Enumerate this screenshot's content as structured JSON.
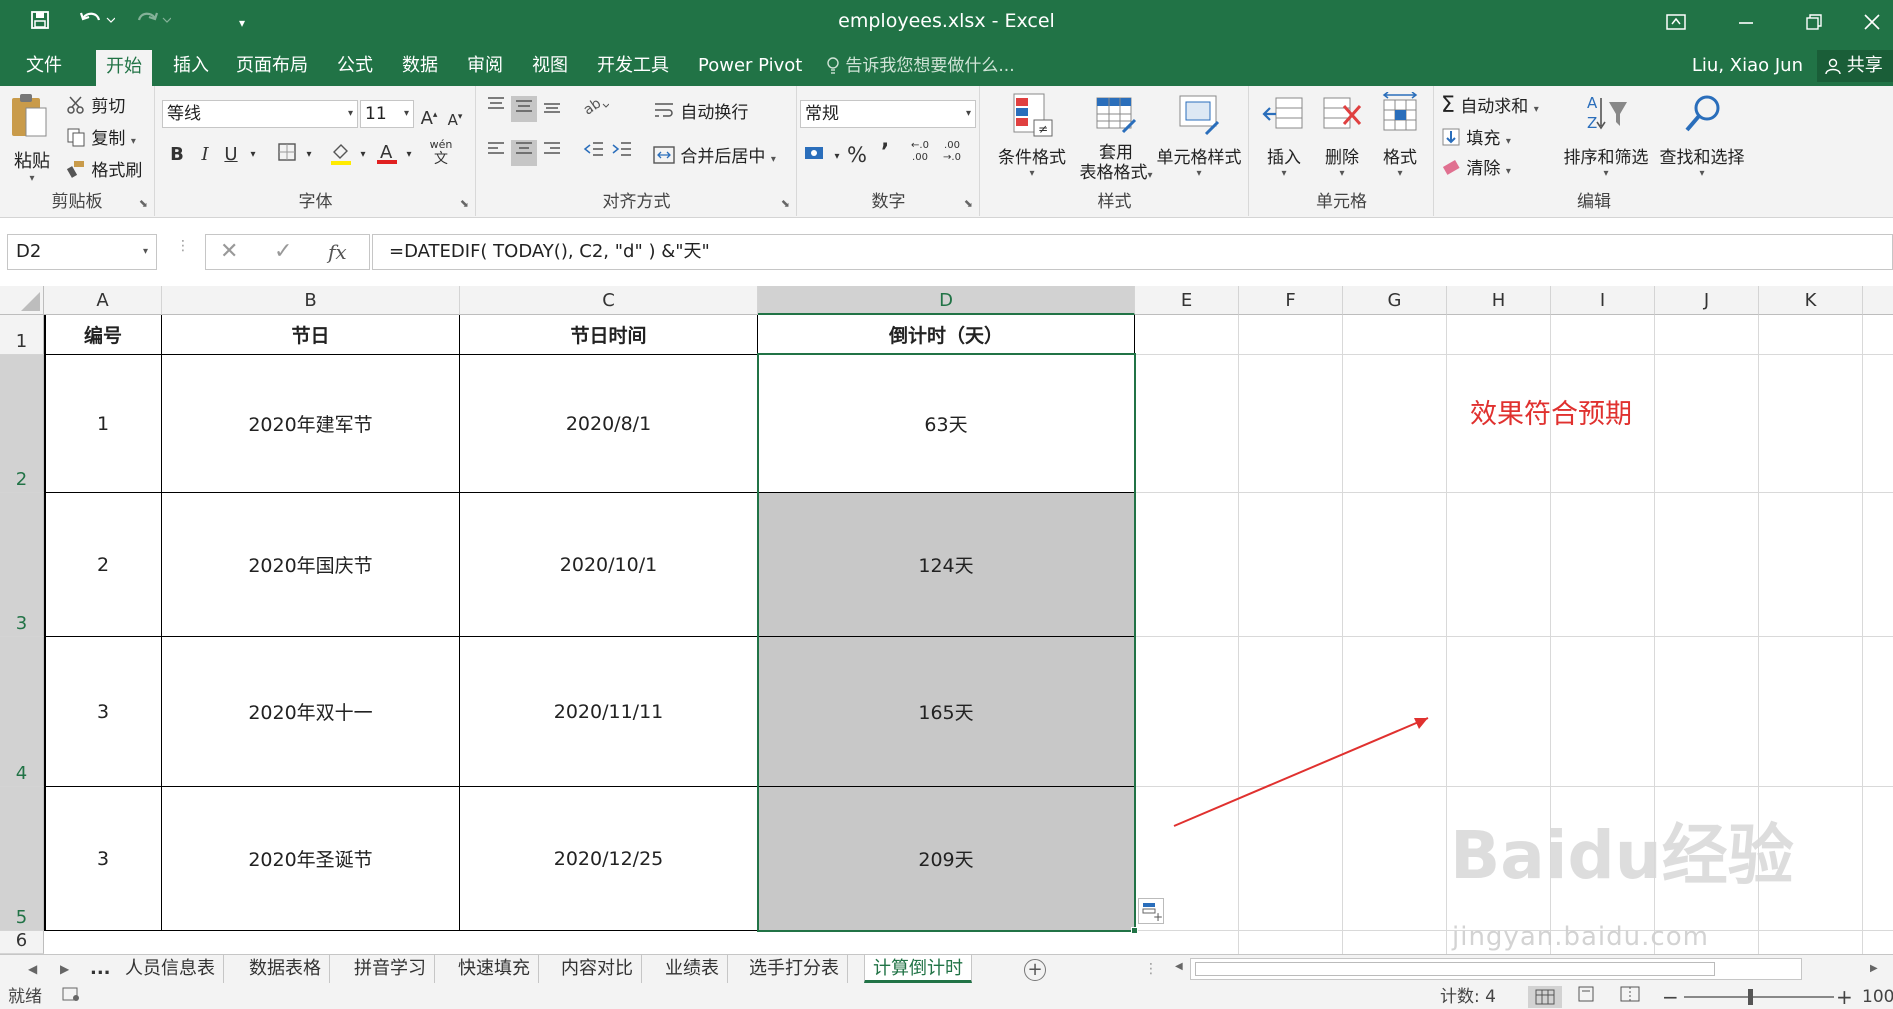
{
  "window": {
    "title": "employees.xlsx - Excel",
    "save_icon": "save-icon",
    "undo_icon": "undo-icon",
    "redo_icon": "redo-icon",
    "customize_icon": "customize-qat-icon"
  },
  "menu": {
    "tabs": [
      "文件",
      "开始",
      "插入",
      "页面布局",
      "公式",
      "数据",
      "审阅",
      "视图",
      "开发工具",
      "Power Pivot"
    ],
    "active_tab": "开始",
    "tell_me": "告诉我您想要做什么...",
    "user": "Liu, Xiao Jun",
    "share": "共享"
  },
  "ribbon": {
    "clipboard": {
      "paste": "粘贴",
      "cut": "剪切",
      "copy": "复制",
      "format_painter": "格式刷",
      "name": "剪贴板"
    },
    "font": {
      "font_name": "等线",
      "font_size": "11",
      "bold": "B",
      "italic": "I",
      "underline": "U",
      "wen": "wén",
      "name": "字体"
    },
    "alignment": {
      "wrap_text": "自动换行",
      "merge_center": "合并后居中",
      "name": "对齐方式"
    },
    "number": {
      "format": "常规",
      "percent": "%",
      "comma": "’",
      "name": "数字"
    },
    "styles": {
      "conditional": "条件格式",
      "table_1": "套用",
      "table_2": "表格格式",
      "cell_styles": "单元格样式",
      "name": "样式"
    },
    "cells": {
      "insert": "插入",
      "delete": "删除",
      "format": "格式",
      "name": "单元格"
    },
    "editing": {
      "autosum": "自动求和",
      "fill": "填充",
      "clear": "清除",
      "sort_filter": "排序和筛选",
      "find_select": "查找和选择",
      "name": "编辑"
    }
  },
  "formula_bar": {
    "name_box": "D2",
    "formula": "=DATEDIF( TODAY(), C2, \"d\" ) &\"天\"",
    "fx": "fx"
  },
  "grid": {
    "columns": [
      "A",
      "B",
      "C",
      "D",
      "E",
      "F",
      "G",
      "H",
      "I",
      "J",
      "K"
    ],
    "rows": [
      "1",
      "2",
      "3",
      "4",
      "5",
      "6"
    ],
    "header": [
      "编号",
      "节日",
      "节日时间",
      "倒计时（天）"
    ],
    "data": [
      [
        "1",
        "2020年建军节",
        "2020/8/1",
        "63天"
      ],
      [
        "2",
        "2020年国庆节",
        "2020/10/1",
        "124天"
      ],
      [
        "3",
        "2020年双十一",
        "2020/11/11",
        "165天"
      ],
      [
        "3",
        "2020年圣诞节",
        "2020/12/25",
        "209天"
      ]
    ]
  },
  "annotation": "效果符合预期",
  "watermark": {
    "logo": "Baidu经验",
    "url": "jingyan.baidu.com"
  },
  "sheets": {
    "tabs": [
      "...",
      "人员信息表",
      "数据表格",
      "拼音学习",
      "快速填充",
      "内容对比",
      "业绩表",
      "选手打分表",
      "计算倒计时"
    ],
    "active": "计算倒计时"
  },
  "status": {
    "mode": "就绪",
    "count": "计数: 4",
    "zoom": "100"
  },
  "colors": {
    "accent": "#217346",
    "annotation": "#e0312f",
    "shade": "#c8c8c8"
  }
}
